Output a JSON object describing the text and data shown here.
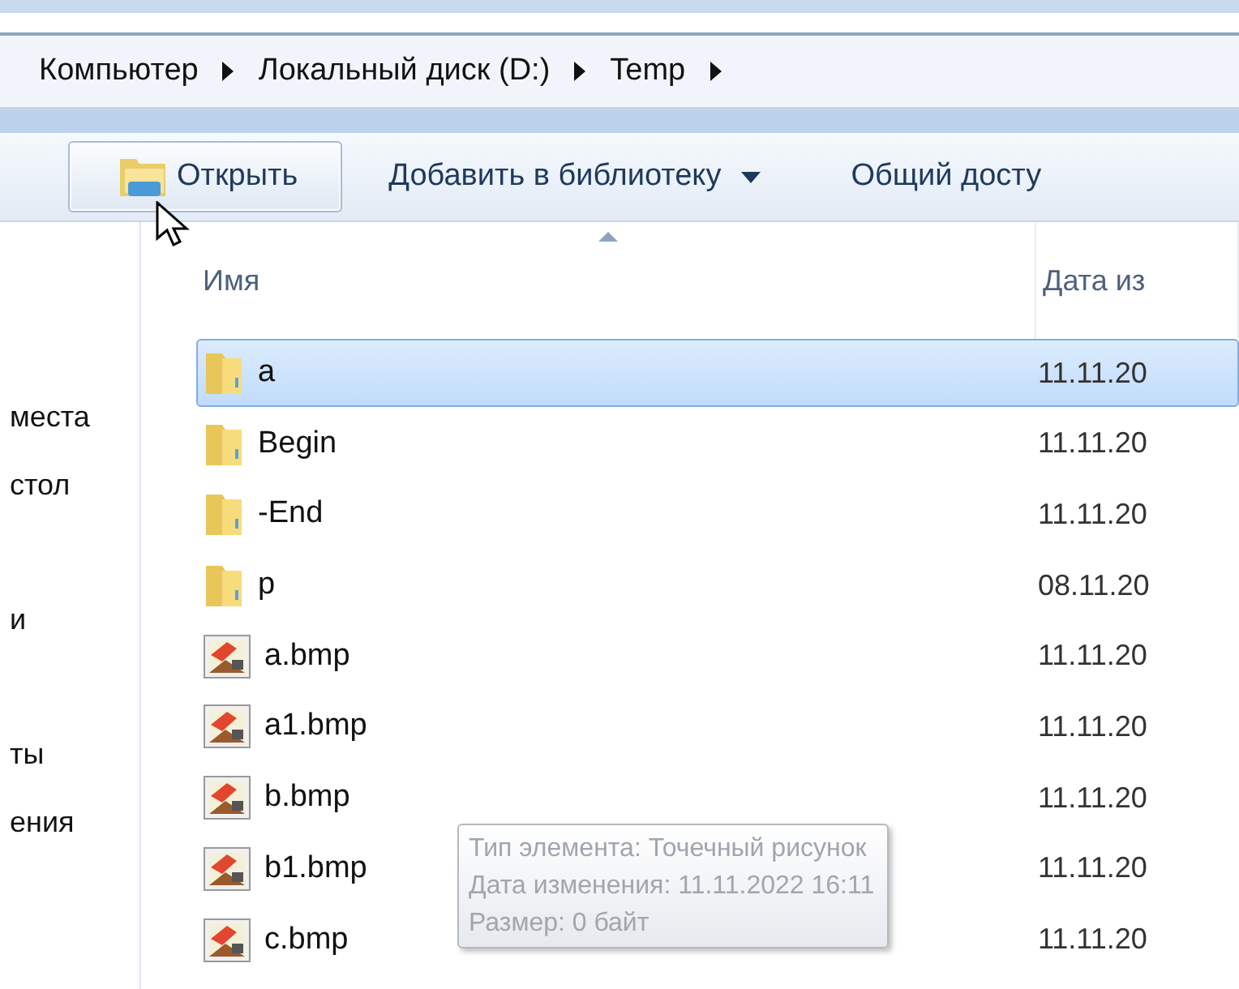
{
  "breadcrumb": [
    "Компьютер",
    "Локальный диск (D:)",
    "Temp"
  ],
  "toolbar": {
    "buttons": [
      {
        "label": "Открыть",
        "kind": "open",
        "hovered": true
      },
      {
        "label": "Добавить в библиотеку",
        "kind": "dropdown",
        "hovered": false
      },
      {
        "label": "Общий досту",
        "kind": "plain",
        "hovered": false
      }
    ]
  },
  "nav_pane": {
    "items": [
      {
        "label": "места"
      },
      {
        "label": "стол"
      },
      {
        "label": "и"
      },
      {
        "label": "ты"
      },
      {
        "label": "ения"
      }
    ]
  },
  "columns": [
    {
      "label": "Имя",
      "sorted": true
    },
    {
      "label": "Дата из",
      "sorted": false
    }
  ],
  "files": [
    {
      "name": "a",
      "kind": "folder",
      "date": "11.11.20",
      "selected": true
    },
    {
      "name": "Begin",
      "kind": "folder",
      "date": "11.11.20",
      "selected": false
    },
    {
      "name": "-End",
      "kind": "folder",
      "date": "11.11.20",
      "selected": false
    },
    {
      "name": "p",
      "kind": "folder",
      "date": "08.11.20",
      "selected": false
    },
    {
      "name": "a.bmp",
      "kind": "bitmap",
      "date": "11.11.20",
      "selected": false
    },
    {
      "name": "a1.bmp",
      "kind": "bitmap",
      "date": "11.11.20",
      "selected": false
    },
    {
      "name": "b.bmp",
      "kind": "bitmap",
      "date": "11.11.20",
      "selected": false
    },
    {
      "name": "b1.bmp",
      "kind": "bitmap",
      "date": "11.11.20",
      "selected": false
    },
    {
      "name": "c.bmp",
      "kind": "bitmap",
      "date": "11.11.20",
      "selected": false
    }
  ],
  "tooltip": {
    "lines": [
      "Тип элемента: Точечный рисунок",
      "Дата изменения: 11.11.2022 16:11",
      "Размер: 0 байт"
    ]
  }
}
